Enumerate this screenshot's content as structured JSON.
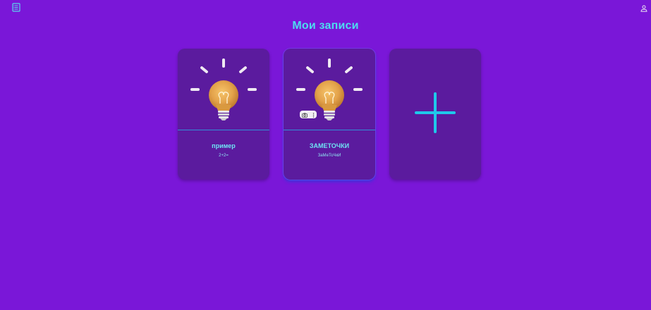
{
  "header": {
    "notes_icon": "notes-list-icon",
    "user_icon": "user-icon"
  },
  "main": {
    "title": "Мои записи",
    "cards": [
      {
        "title": "пример",
        "text": "2+2=",
        "image_icon": "lightbulb-icon"
      },
      {
        "title": "ЗАМЕТОЧКИ",
        "text": "ЗаМеТоЧкИ",
        "image_icon": "lightbulb-icon"
      }
    ],
    "image_toolbar": {
      "camera_icon": "camera-icon",
      "more_icon": "more-vertical-icon"
    },
    "add_card_icon": "plus-icon"
  },
  "colors": {
    "background": "#7a17d8",
    "card": "#5b1b9e",
    "accent": "#4ddcf0",
    "plus": "#1fc8ea"
  }
}
